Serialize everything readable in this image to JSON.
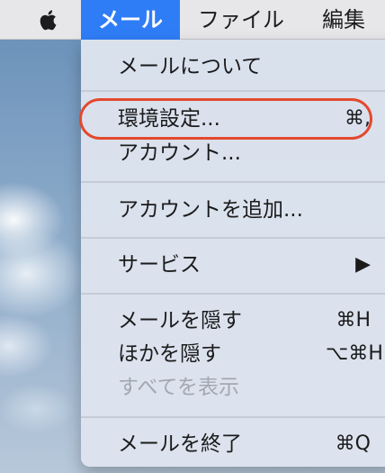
{
  "menubar": {
    "apple_icon": "apple-icon",
    "mail": "メール",
    "file": "ファイル",
    "edit": "編集"
  },
  "mail_menu": {
    "about": "メールについて",
    "preferences": {
      "label": "環境設定...",
      "shortcut": "⌘,"
    },
    "accounts": "アカウント...",
    "add_account": "アカウントを追加...",
    "services": {
      "label": "サービス",
      "arrow": "▶"
    },
    "hide_mail": {
      "label": "メールを隠す",
      "shortcut": "⌘H"
    },
    "hide_others": {
      "label": "ほかを隠す",
      "shortcut": "⌥⌘H"
    },
    "show_all": "すべてを表示",
    "quit_mail": {
      "label": "メールを終了",
      "shortcut": "⌘Q"
    }
  },
  "colors": {
    "menubar_bg": "#e7e7e9",
    "selected_menu_bg": "#2f7df6",
    "highlight_ring": "#e3492d",
    "disabled_text": "#a3a8b0"
  }
}
